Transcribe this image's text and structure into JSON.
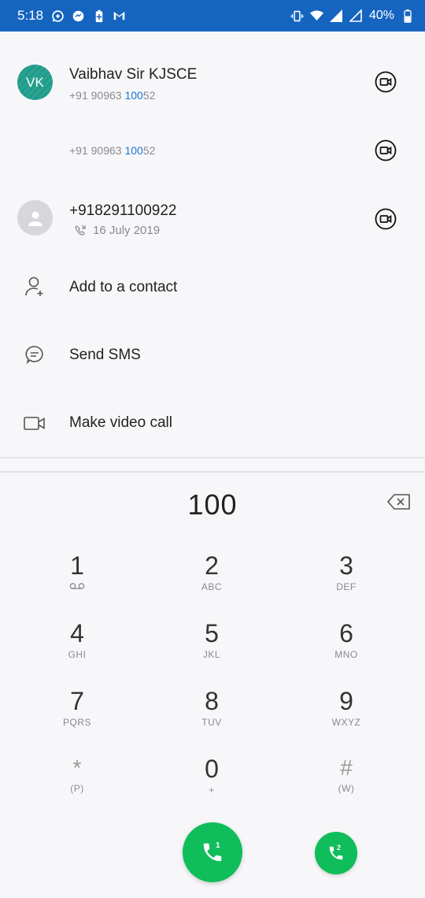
{
  "status_bar": {
    "time": "5:18",
    "left_icons": [
      "whatsapp-icon",
      "messenger-icon",
      "battery-saver-icon",
      "gmail-icon"
    ],
    "right_icons": [
      "vibrate-icon",
      "wifi-icon",
      "signal-icon",
      "signal-outline-icon",
      "battery-icon"
    ],
    "battery": "40%",
    "color": "#1565c0"
  },
  "results": [
    {
      "avatar": "VK",
      "avatar_color": "#1e9b8a",
      "name": "Vaibhav Sir KJSCE",
      "number_prefix": "+91 90963 ",
      "number_match": "100",
      "number_suffix": "52"
    },
    {
      "number_prefix": "+91 90963 ",
      "number_match": "100",
      "number_suffix": "52"
    },
    {
      "name": "+918291100922",
      "call_date": "16 July 2019",
      "call_icon": "missed-call-icon"
    }
  ],
  "actions": [
    {
      "label": "Add to a contact",
      "icon": "add-contact-icon"
    },
    {
      "label": "Send SMS",
      "icon": "sms-icon"
    },
    {
      "label": "Make video call",
      "icon": "video-call-icon"
    }
  ],
  "dialer": {
    "entered": "100",
    "keys": [
      {
        "digit": "1",
        "letters": ""
      },
      {
        "digit": "2",
        "letters": "ABC"
      },
      {
        "digit": "3",
        "letters": "DEF"
      },
      {
        "digit": "4",
        "letters": "GHI"
      },
      {
        "digit": "5",
        "letters": "JKL"
      },
      {
        "digit": "6",
        "letters": "MNO"
      },
      {
        "digit": "7",
        "letters": "PQRS"
      },
      {
        "digit": "8",
        "letters": "TUV"
      },
      {
        "digit": "9",
        "letters": "WXYZ"
      },
      {
        "digit": "*",
        "letters": "(P)"
      },
      {
        "digit": "0",
        "letters": "+"
      },
      {
        "digit": "#",
        "letters": "(W)"
      }
    ],
    "call_sim1_label": "1",
    "call_sim2_label": "2",
    "call_color": "#0fbd5a",
    "accent": "#1976d2"
  }
}
